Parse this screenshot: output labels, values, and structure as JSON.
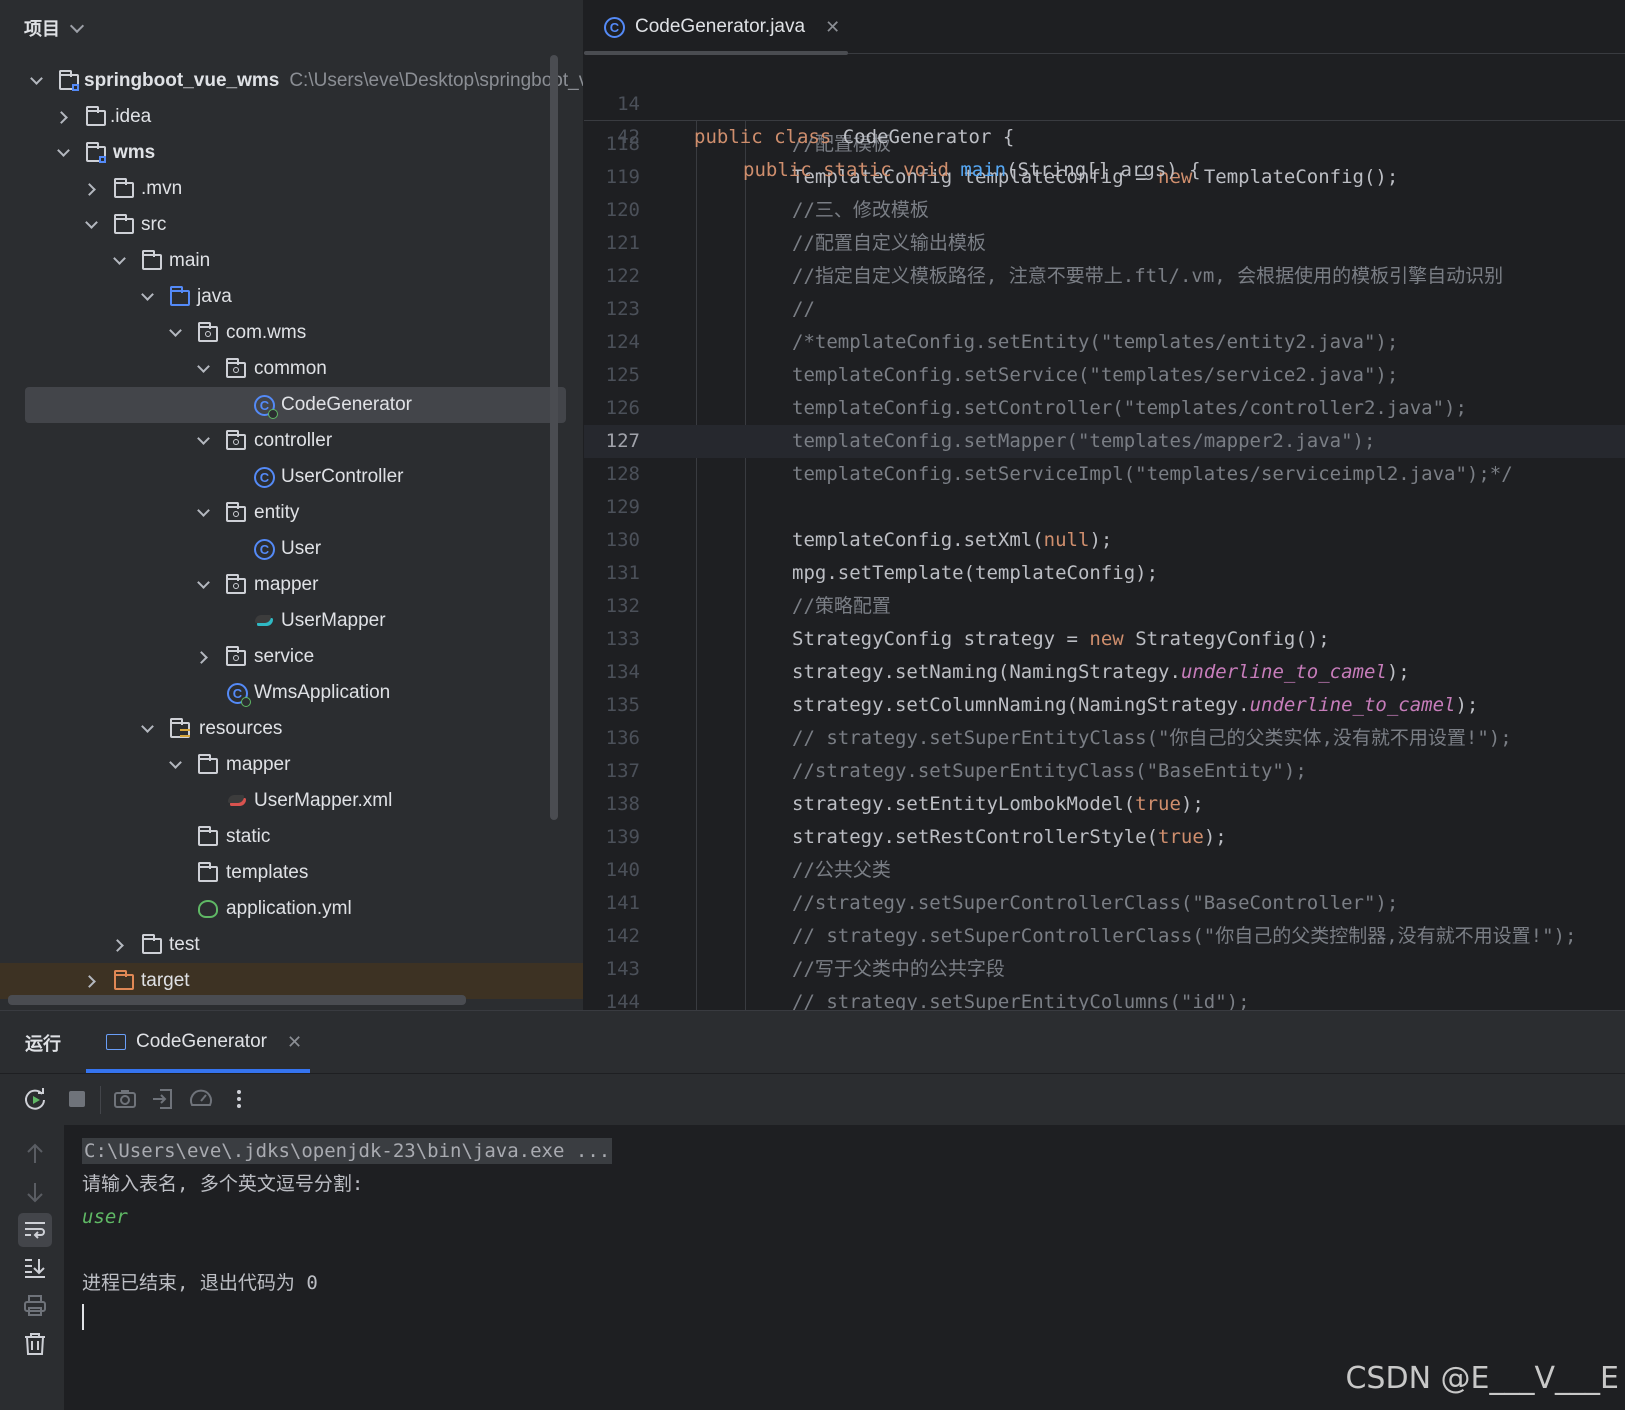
{
  "project_panel": {
    "title": "项目",
    "tree": [
      {
        "label": "springboot_vue_wms",
        "path": "C:\\Users\\eve\\Desktop\\springboot_v"
      },
      {
        "label": ".idea"
      },
      {
        "label": "wms"
      },
      {
        "label": ".mvn"
      },
      {
        "label": "src"
      },
      {
        "label": "main"
      },
      {
        "label": "java"
      },
      {
        "label": "com.wms"
      },
      {
        "label": "common"
      },
      {
        "label": "CodeGenerator"
      },
      {
        "label": "controller"
      },
      {
        "label": "UserController"
      },
      {
        "label": "entity"
      },
      {
        "label": "User"
      },
      {
        "label": "mapper"
      },
      {
        "label": "UserMapper"
      },
      {
        "label": "service"
      },
      {
        "label": "WmsApplication"
      },
      {
        "label": "resources"
      },
      {
        "label": "mapper"
      },
      {
        "label": "UserMapper.xml"
      },
      {
        "label": "static"
      },
      {
        "label": "templates"
      },
      {
        "label": "application.yml"
      },
      {
        "label": "test"
      },
      {
        "label": "target"
      }
    ]
  },
  "editor": {
    "tab_label": "CodeGenerator.java",
    "sticky": [
      {
        "ln": "14",
        "kw": "public class ",
        "rest": "CodeGenerator {"
      },
      {
        "ln": "42",
        "kw": "public static void ",
        "fn": "main",
        "rest": "(String[] args) {"
      }
    ],
    "lines": {
      "118": {
        "ln": "118",
        "c": "//配置模板"
      },
      "119": {
        "ln": "119",
        "a": "TemplateConfig templateConfig = ",
        "k": "new",
        "b": " TemplateConfig();"
      },
      "120": {
        "ln": "120",
        "c": "//三、修改模板"
      },
      "121": {
        "ln": "121",
        "c": "//配置自定义输出模板"
      },
      "122": {
        "ln": "122",
        "c": "//指定自定义模板路径, 注意不要带上.ftl/.vm, 会根据使用的模板引擎自动识别"
      },
      "123": {
        "ln": "123",
        "c": "//"
      },
      "124": {
        "ln": "124",
        "c": "/*templateConfig.setEntity(\"templates/entity2.java\");"
      },
      "125": {
        "ln": "125",
        "c": "templateConfig.setService(\"templates/service2.java\");"
      },
      "126": {
        "ln": "126",
        "c": "templateConfig.setController(\"templates/controller2.java\");"
      },
      "127": {
        "ln": "127",
        "c": "templateConfig.setMapper(\"templates/mapper2.java\");"
      },
      "128": {
        "ln": "128",
        "c": "templateConfig.setServiceImpl(\"templates/serviceimpl2.java\");*/"
      },
      "129": {
        "ln": "129"
      },
      "130": {
        "ln": "130",
        "a": "templateConfig.setXml(",
        "k": "null",
        "b": ");"
      },
      "131": {
        "ln": "131",
        "a": "mpg.setTemplate(templateConfig);"
      },
      "132": {
        "ln": "132",
        "c": "//策略配置"
      },
      "133": {
        "ln": "133",
        "a": "StrategyConfig strategy = ",
        "k": "new",
        "b": " StrategyConfig();"
      },
      "134": {
        "ln": "134",
        "a": "strategy.setNaming(NamingStrategy.",
        "s": "underline_to_camel",
        "b": ");"
      },
      "135": {
        "ln": "135",
        "a": "strategy.setColumnNaming(NamingStrategy.",
        "s": "underline_to_camel",
        "b": ");"
      },
      "136": {
        "ln": "136",
        "c": "// strategy.setSuperEntityClass(\"你自己的父类实体,没有就不用设置!\");"
      },
      "137": {
        "ln": "137",
        "c": "//strategy.setSuperEntityClass(\"BaseEntity\");"
      },
      "138": {
        "ln": "138",
        "a": "strategy.setEntityLombokModel(",
        "k": "true",
        "b": ");"
      },
      "139": {
        "ln": "139",
        "a": "strategy.setRestControllerStyle(",
        "k": "true",
        "b": ");"
      },
      "140": {
        "ln": "140",
        "c": "//公共父类"
      },
      "141": {
        "ln": "141",
        "c": "//strategy.setSuperControllerClass(\"BaseController\");"
      },
      "142": {
        "ln": "142",
        "c": "// strategy.setSuperControllerClass(\"你自己的父类控制器,没有就不用设置!\");"
      },
      "143": {
        "ln": "143",
        "c": "//写于父类中的公共字段"
      },
      "144": {
        "ln": "144",
        "c": "// strategy.setSuperEntityColumns(\"id\");"
      }
    }
  },
  "run_panel": {
    "title": "运行",
    "tab_label": "CodeGenerator",
    "console": {
      "command": "C:\\Users\\eve\\.jdks\\openjdk-23\\bin\\java.exe ...",
      "prompt": "请输入表名, 多个英文逗号分割:",
      "input": "user",
      "exit": "进程已结束, 退出代码为 0"
    }
  },
  "watermark": "CSDN @E___V___E"
}
